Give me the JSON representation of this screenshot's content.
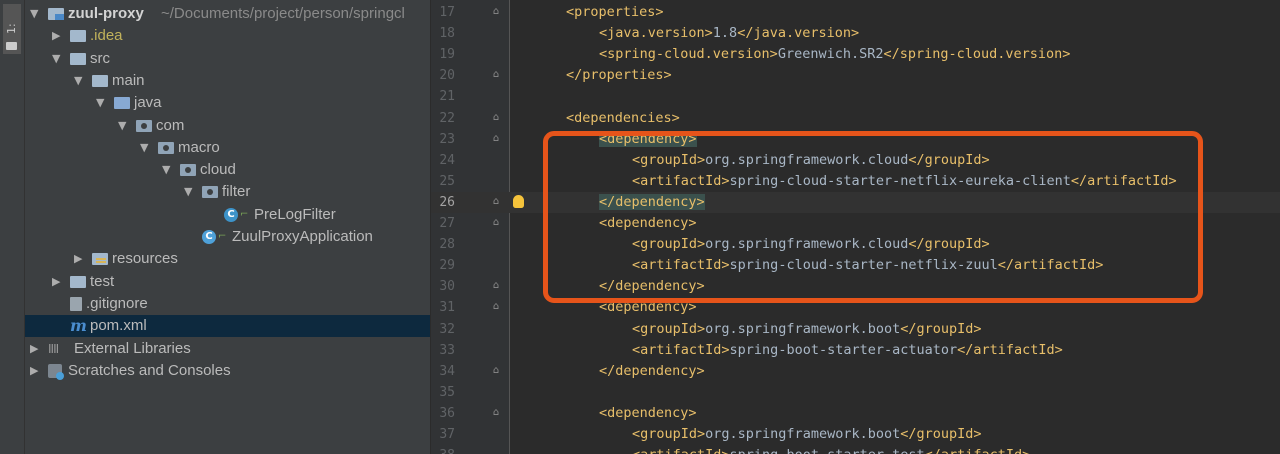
{
  "toolwindow": {
    "label": "1: Project"
  },
  "tree": [
    {
      "label": "zuul-proxy",
      "extra": "~/Documents/project/person/springcl",
      "icon": "project-folder-icon",
      "depth": 0,
      "arrow": "▼",
      "style": "bold"
    },
    {
      "label": ".idea",
      "icon": "folder-icon",
      "depth": 1,
      "arrow": "▶",
      "style": "idea"
    },
    {
      "label": "src",
      "icon": "folder-icon",
      "depth": 1,
      "arrow": "▼"
    },
    {
      "label": "main",
      "icon": "folder-icon",
      "depth": 2,
      "arrow": "▼"
    },
    {
      "label": "java",
      "icon": "source-folder-icon",
      "depth": 3,
      "arrow": "▼"
    },
    {
      "label": "com",
      "icon": "package-icon",
      "depth": 4,
      "arrow": "▼"
    },
    {
      "label": "macro",
      "icon": "package-icon",
      "depth": 5,
      "arrow": "▼"
    },
    {
      "label": "cloud",
      "icon": "package-icon",
      "depth": 6,
      "arrow": "▼"
    },
    {
      "label": "filter",
      "icon": "package-icon",
      "depth": 7,
      "arrow": "▼"
    },
    {
      "label": "PreLogFilter",
      "icon": "class-icon",
      "depth": 8,
      "arrow": ""
    },
    {
      "label": "ZuulProxyApplication",
      "icon": "spring-class-icon",
      "depth": 7,
      "arrow": ""
    },
    {
      "label": "resources",
      "icon": "resources-folder-icon",
      "depth": 2,
      "arrow": "▶"
    },
    {
      "label": "test",
      "icon": "folder-icon",
      "depth": 1,
      "arrow": "▶"
    },
    {
      "label": ".gitignore",
      "icon": "gitignore-icon",
      "depth": 1,
      "arrow": ""
    },
    {
      "label": "pom.xml",
      "icon": "maven-icon",
      "depth": 1,
      "arrow": "",
      "selected": true
    },
    {
      "label": "External Libraries",
      "icon": "libraries-icon",
      "depth": 0,
      "arrow": "▶"
    },
    {
      "label": "Scratches and Consoles",
      "icon": "scratches-icon",
      "depth": 0,
      "arrow": "▶"
    }
  ],
  "editor": {
    "current_line": 26,
    "bulb_line": 26,
    "lines": [
      {
        "n": 17,
        "indent": 1,
        "parts": [
          [
            "tag",
            "<properties>"
          ]
        ],
        "fold": "⌂"
      },
      {
        "n": 18,
        "indent": 2,
        "parts": [
          [
            "tag",
            "<java.version>"
          ],
          [
            "txt",
            "1.8"
          ],
          [
            "tag",
            "</java.version>"
          ]
        ]
      },
      {
        "n": 19,
        "indent": 2,
        "parts": [
          [
            "tag",
            "<spring-cloud.version>"
          ],
          [
            "txt",
            "Greenwich.SR2"
          ],
          [
            "tag",
            "</spring-cloud.version>"
          ]
        ]
      },
      {
        "n": 20,
        "indent": 1,
        "parts": [
          [
            "tag",
            "</properties>"
          ]
        ],
        "fold": "⌂"
      },
      {
        "n": 21,
        "indent": 0,
        "parts": []
      },
      {
        "n": 22,
        "indent": 1,
        "parts": [
          [
            "tag",
            "<dependencies>"
          ]
        ],
        "fold": "⌂"
      },
      {
        "n": 23,
        "indent": 2,
        "parts": [
          [
            "tag-hl",
            "<dependency>"
          ]
        ],
        "fold": "⌂"
      },
      {
        "n": 24,
        "indent": 3,
        "parts": [
          [
            "tag",
            "<groupId>"
          ],
          [
            "txt",
            "org.springframework.cloud"
          ],
          [
            "tag",
            "</groupId>"
          ]
        ]
      },
      {
        "n": 25,
        "indent": 3,
        "parts": [
          [
            "tag",
            "<artifactId>"
          ],
          [
            "txt",
            "spring-cloud-starter-netflix-eureka-client"
          ],
          [
            "tag",
            "</artifactId>"
          ]
        ]
      },
      {
        "n": 26,
        "indent": 2,
        "parts": [
          [
            "tag-hl",
            "</dependency>"
          ]
        ],
        "fold": "⌂"
      },
      {
        "n": 27,
        "indent": 2,
        "parts": [
          [
            "tag",
            "<dependency>"
          ]
        ],
        "fold": "⌂"
      },
      {
        "n": 28,
        "indent": 3,
        "parts": [
          [
            "tag",
            "<groupId>"
          ],
          [
            "txt",
            "org.springframework.cloud"
          ],
          [
            "tag",
            "</groupId>"
          ]
        ]
      },
      {
        "n": 29,
        "indent": 3,
        "parts": [
          [
            "tag",
            "<artifactId>"
          ],
          [
            "txt",
            "spring-cloud-starter-netflix-zuul"
          ],
          [
            "tag",
            "</artifactId>"
          ]
        ]
      },
      {
        "n": 30,
        "indent": 2,
        "parts": [
          [
            "tag",
            "</dependency>"
          ]
        ],
        "fold": "⌂"
      },
      {
        "n": 31,
        "indent": 2,
        "parts": [
          [
            "tag",
            "<dependency>"
          ]
        ],
        "fold": "⌂"
      },
      {
        "n": 32,
        "indent": 3,
        "parts": [
          [
            "tag",
            "<groupId>"
          ],
          [
            "txt",
            "org.springframework.boot"
          ],
          [
            "tag",
            "</groupId>"
          ]
        ]
      },
      {
        "n": 33,
        "indent": 3,
        "parts": [
          [
            "tag",
            "<artifactId>"
          ],
          [
            "txt",
            "spring-boot-starter-actuator"
          ],
          [
            "tag",
            "</artifactId>"
          ]
        ]
      },
      {
        "n": 34,
        "indent": 2,
        "parts": [
          [
            "tag",
            "</dependency>"
          ]
        ],
        "fold": "⌂"
      },
      {
        "n": 35,
        "indent": 0,
        "parts": []
      },
      {
        "n": 36,
        "indent": 2,
        "parts": [
          [
            "tag",
            "<dependency>"
          ]
        ],
        "fold": "⌂"
      },
      {
        "n": 37,
        "indent": 3,
        "parts": [
          [
            "tag",
            "<groupId>"
          ],
          [
            "txt",
            "org.springframework.boot"
          ],
          [
            "tag",
            "</groupId>"
          ]
        ]
      },
      {
        "n": 38,
        "indent": 3,
        "parts": [
          [
            "tag",
            "<artifactId>"
          ],
          [
            "txt",
            "spring-boot-starter-test"
          ],
          [
            "tag",
            "</artifactId>"
          ]
        ]
      }
    ]
  },
  "annotation": {
    "color": "#e6541a"
  }
}
